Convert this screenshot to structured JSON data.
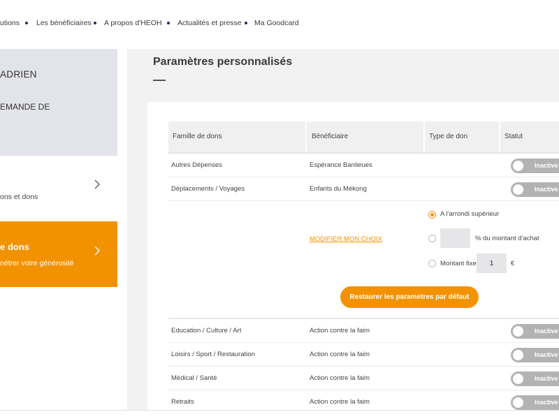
{
  "nav": {
    "items": [
      "utions",
      "Les bénéficiaires",
      "A propos d'HEOH",
      "Actualités et presse",
      "Ma Goodcard"
    ]
  },
  "sidebar": {
    "user_name": "ADRIEN",
    "demande": "EMANDE DE",
    "item1_sub": "ons et dons",
    "item2_title": "e dons",
    "item2_sub": "nétrer votre générosité"
  },
  "main": {
    "title": "Paramètres personnalisés",
    "table": {
      "headers": [
        "Famille de dons",
        "Bénéficiaire",
        "Type de don",
        "Statut"
      ],
      "rows_top": [
        {
          "famille": "Autres Dépenses",
          "beneficiaire": "Espérance Banlieues",
          "statut": "Inactive"
        },
        {
          "famille": "Déplacements / Voyages",
          "beneficiaire": "Enfants du Mékong",
          "statut": "Inactive"
        }
      ],
      "rows_bottom": [
        {
          "famille": "Education / Culture / Art",
          "beneficiaire": "Action contre la faim",
          "statut": "Inactive"
        },
        {
          "famille": "Loisirs / Sport / Restauration",
          "beneficiaire": "Action contre la faim",
          "statut": "Inactive"
        },
        {
          "famille": "Médical / Santé",
          "beneficiaire": "Action contre la faim",
          "statut": "Inactive"
        },
        {
          "famille": "Retraits",
          "beneficiaire": "Action contre la faim",
          "statut": "Inactive"
        }
      ]
    },
    "modify_link": "MODIFIER MON CHOIX",
    "options": {
      "round_up": "A l'arrondi supérieur",
      "percent": "% du montant d'achat",
      "fixed": "Montant fixe",
      "fixed_value": "1",
      "currency": "€",
      "selected": "round_up"
    },
    "restore_button": "Restaurer les parametres par défaut"
  },
  "colors": {
    "accent": "#f39200",
    "toggle_inactive": "#b3b3b3",
    "nav_dot": "#1f2f5a"
  }
}
